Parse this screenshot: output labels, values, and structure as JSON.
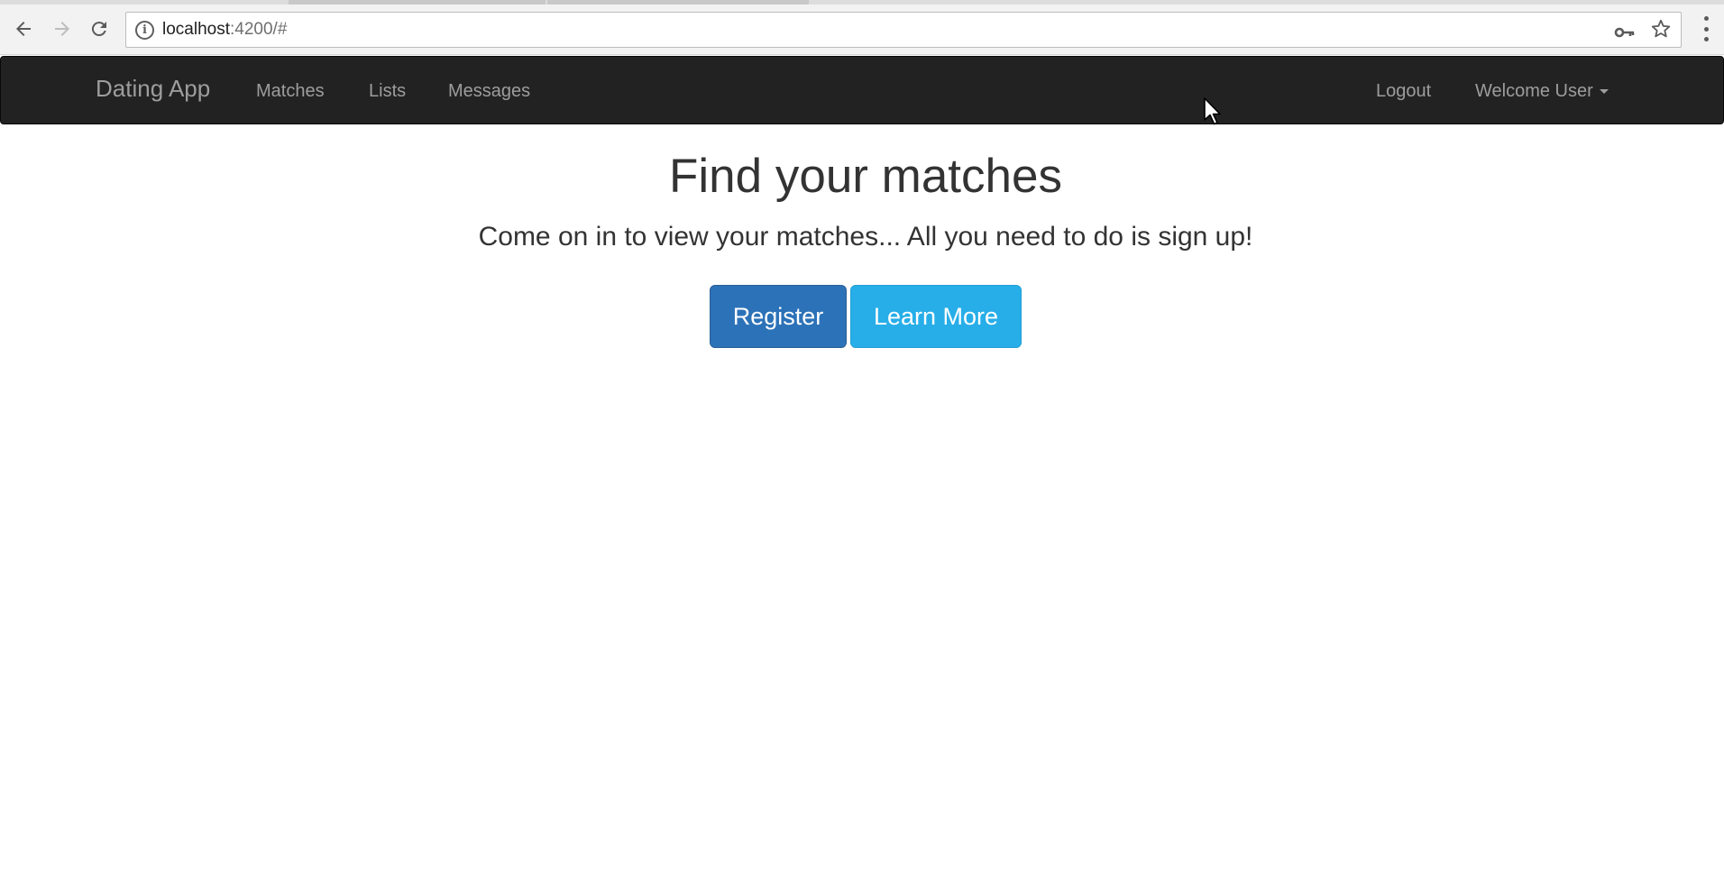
{
  "browser": {
    "url_host": "localhost",
    "url_rest": ":4200/#"
  },
  "navbar": {
    "brand": "Dating App",
    "links": [
      "Matches",
      "Lists",
      "Messages"
    ],
    "logout": "Logout",
    "user_menu": "Welcome User"
  },
  "hero": {
    "title": "Find your matches",
    "lead": "Come on in to view your matches... All you need to do is sign up!",
    "register_label": "Register",
    "learn_more_label": "Learn More"
  },
  "colors": {
    "navbar_bg": "#222222",
    "nav_text": "#9d9d9d",
    "primary": "#2c72b8",
    "info": "#27aee8"
  }
}
